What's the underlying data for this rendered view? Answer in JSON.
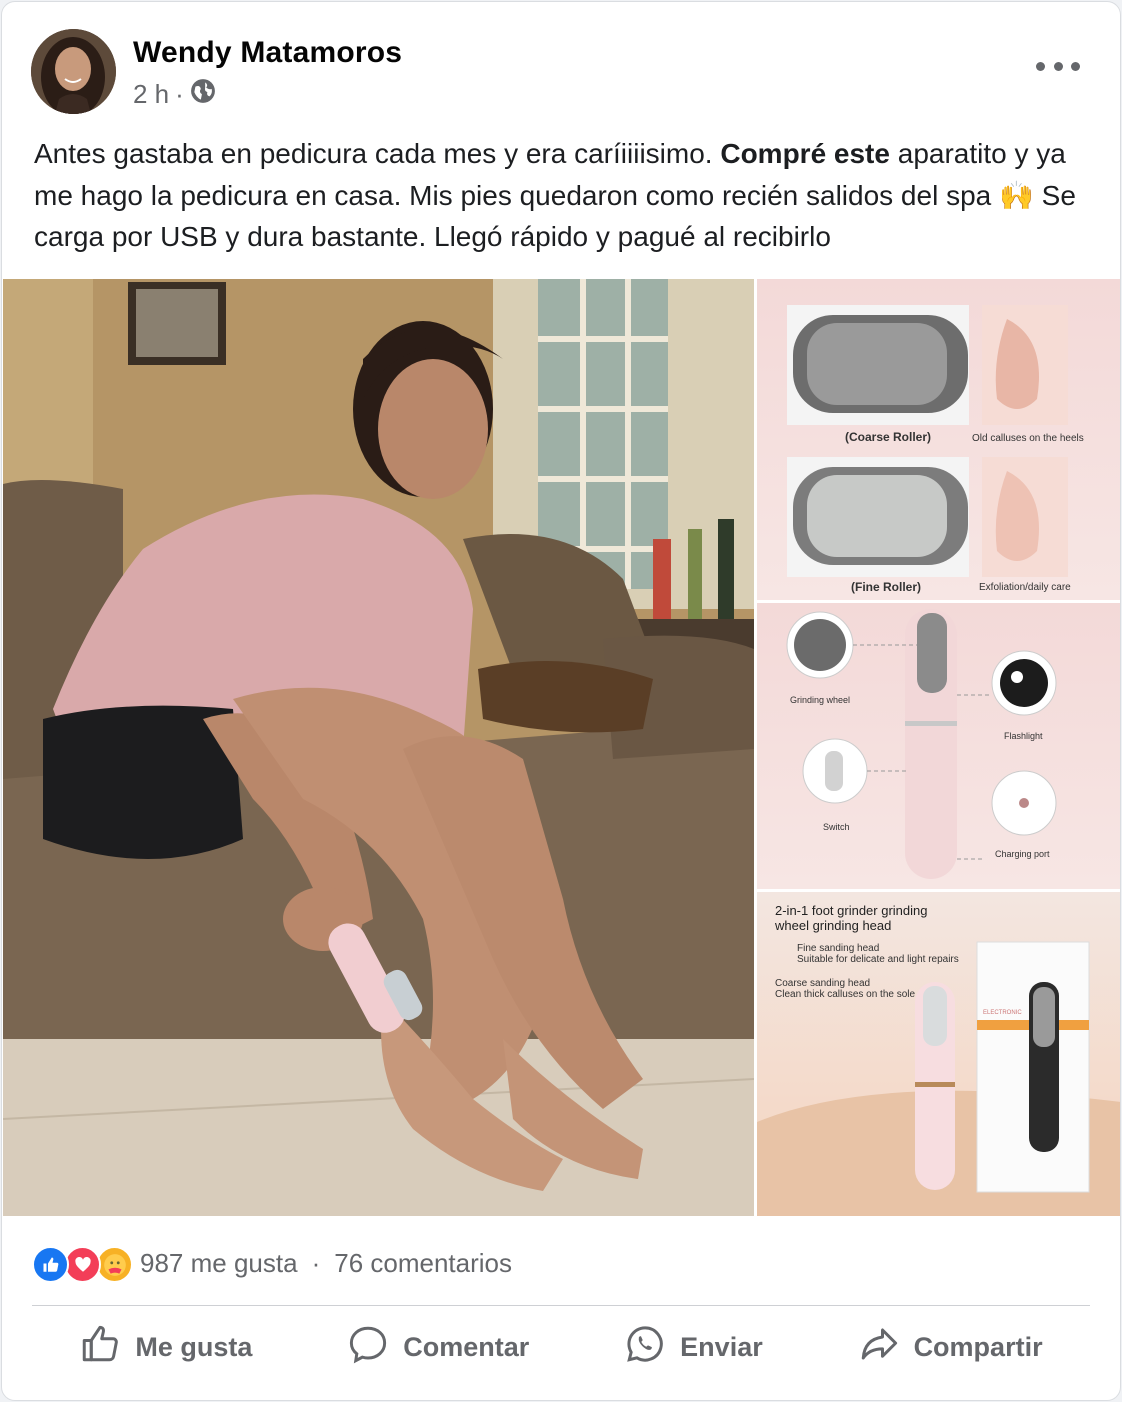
{
  "post": {
    "author": "Wendy Matamoros",
    "time": "2 h",
    "separator": "·",
    "text_part1": "Antes gastaba en pedicura cada mes y era caríiiiisimo. ",
    "text_bold": "Compré este",
    "text_part2": " aparatito y ya me hago la pedicura en casa. Mis pies quedaron como recién salidos del spa 🙌 Se carga por USB y dura bastante. Llegó rápido y pagué al recibirlo"
  },
  "media": {
    "tile1": {
      "coarse_label": "(Coarse Roller)",
      "fine_label": "(Fine Roller)",
      "heels_label": "Old calluses on the heels",
      "exfoliation_label": "Exfoliation/daily care"
    },
    "tile2": {
      "grinding_wheel": "Grinding wheel",
      "flashlight": "Flashlight",
      "switch": "Switch",
      "charging_port": "Charging port"
    },
    "tile3": {
      "title": "2-in-1 foot grinder grinding wheel grinding head",
      "fine_head": "Fine sanding head",
      "fine_desc": "Suitable for delicate and light repairs",
      "coarse_head": "Coarse sanding head",
      "coarse_desc": "Clean thick calluses on the sole",
      "box_label": "ELECTRONIC"
    }
  },
  "stats": {
    "likes": "987 me gusta",
    "dot": "·",
    "comments": "76 comentarios"
  },
  "actions": {
    "like": "Me gusta",
    "comment": "Comentar",
    "send": "Enviar",
    "share": "Compartir"
  },
  "colors": {
    "secondary_text": "#65676b",
    "like_blue": "#1877f2",
    "love_red": "#f33e58",
    "care_yellow": "#f7b125"
  }
}
